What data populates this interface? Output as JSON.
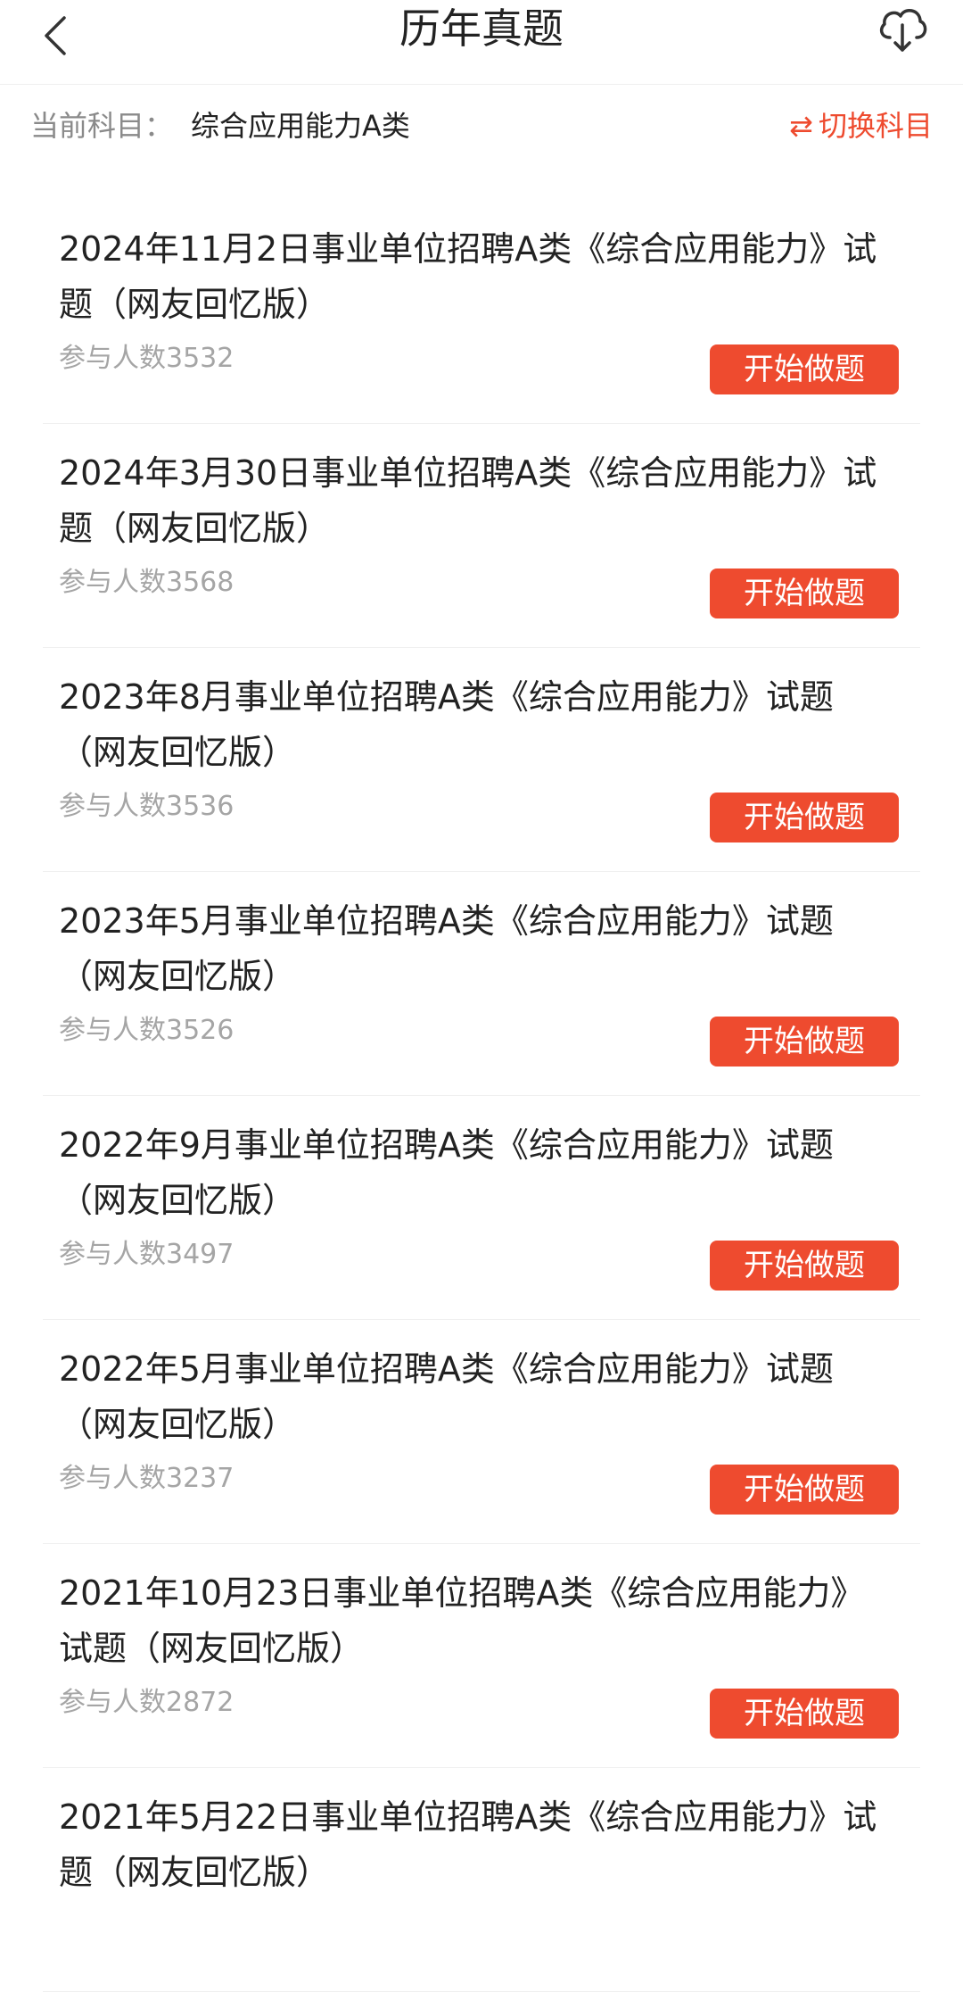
{
  "header": {
    "title": "历年真题"
  },
  "subject": {
    "label": "当前科目：",
    "value": "综合应用能力A类",
    "switch_label": "切换科目",
    "switch_icon": "⇄"
  },
  "list": {
    "button_label": "开始做题",
    "count_prefix": "参与人数",
    "items": [
      {
        "title": "2024年11月2日事业单位招聘A类《综合应用能力》试题（网友回忆版）",
        "count": "参与人数3532"
      },
      {
        "title": "2024年3月30日事业单位招聘A类《综合应用能力》试题（网友回忆版）",
        "count": "参与人数3568"
      },
      {
        "title": "2023年8月事业单位招聘A类《综合应用能力》试题（网友回忆版）",
        "count": "参与人数3536"
      },
      {
        "title": "2023年5月事业单位招聘A类《综合应用能力》试题（网友回忆版）",
        "count": "参与人数3526"
      },
      {
        "title": "2022年9月事业单位招聘A类《综合应用能力》试题（网友回忆版）",
        "count": "参与人数3497"
      },
      {
        "title": "2022年5月事业单位招聘A类《综合应用能力》试题（网友回忆版）",
        "count": "参与人数3237"
      },
      {
        "title": "2021年10月23日事业单位招聘A类《综合应用能力》试题（网友回忆版）",
        "count": "参与人数2872"
      },
      {
        "title": "2021年5月22日事业单位招聘A类《综合应用能力》试题（网友回忆版）",
        "count": ""
      }
    ]
  },
  "colors": {
    "accent": "#ee4b2f",
    "muted_text": "#a5a5a5",
    "primary_text": "#222222"
  },
  "icons": {
    "back": "chevron-left-icon",
    "download": "cloud-download-icon",
    "switch": "swap-arrows-icon"
  }
}
